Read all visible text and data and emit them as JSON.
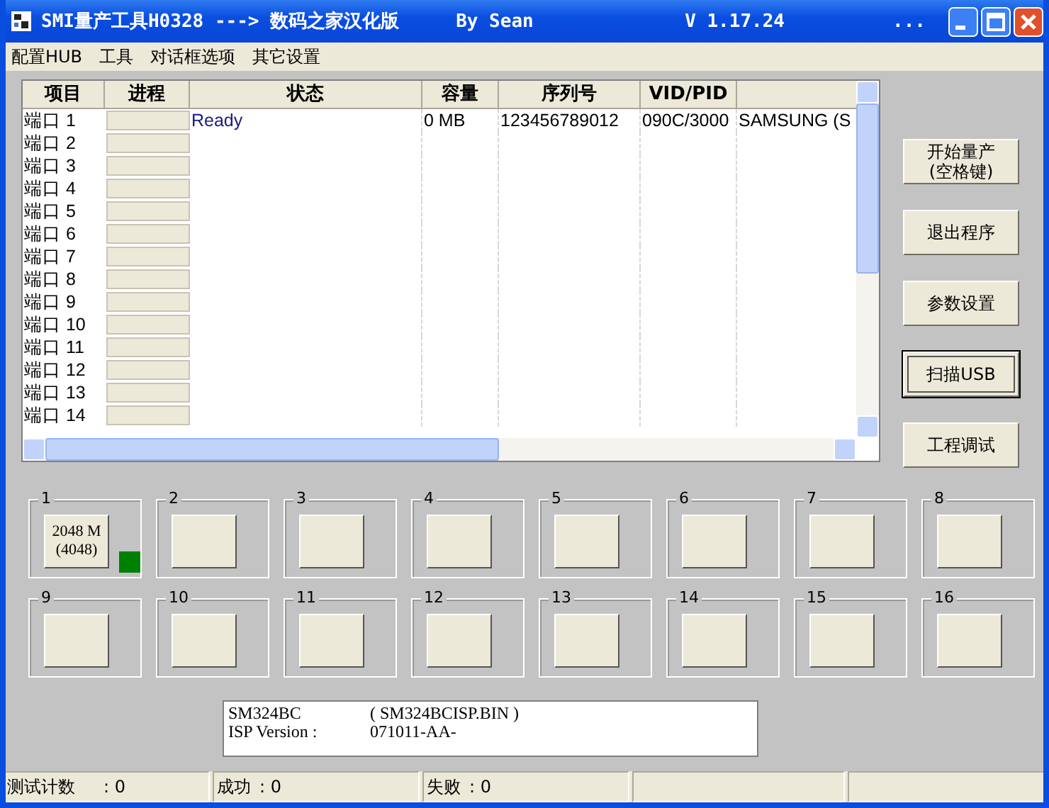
{
  "window": {
    "title": "SMI量产工具H0328 ---> 数码之家汉化版",
    "author": "By Sean",
    "version": "V 1.17.24",
    "extra": "..."
  },
  "menu": [
    "配置HUB",
    "工具",
    "对话框选项",
    "其它设置"
  ],
  "table": {
    "columns": [
      "项目",
      "进程",
      "状态",
      "容量",
      "序列号",
      "VID/PID"
    ],
    "rows": [
      {
        "port": "端口 1",
        "status": "Ready",
        "capacity": "0 MB",
        "serial": "123456789012",
        "vidpid": "090C/3000",
        "column_7": "SAMSUNG (S",
        "level": 0
      },
      {
        "port": "端口 2",
        "level": 0
      },
      {
        "port": "端口 3",
        "level": 0
      },
      {
        "port": "端口 4",
        "level": 0
      },
      {
        "port": "端口 5",
        "level": 0
      },
      {
        "port": "端口 6",
        "level": 0
      },
      {
        "port": "端口 7",
        "level": 0
      },
      {
        "port": "端口 8",
        "level": 0
      },
      {
        "port": "端口 9",
        "level": 0
      },
      {
        "port": "端口 10",
        "level": 0
      },
      {
        "port": "端口 11",
        "level": 0
      },
      {
        "port": "端口 12",
        "level": 0
      },
      {
        "port": "端口 13",
        "level": 0
      },
      {
        "port": "端口 14",
        "level": 0
      }
    ]
  },
  "buttons": [
    {
      "label": "开始量产",
      "label_2": "(空格键)",
      "focused": false
    },
    {
      "label": "退出程序",
      "focused": false
    },
    {
      "label": "参数设置",
      "focused": false
    },
    {
      "label": "扫描USB",
      "focused": true
    },
    {
      "label": "工程调试",
      "focused": false
    }
  ],
  "ports": [
    {
      "number": "1",
      "size": "2048 M",
      "count": "(4048)",
      "color": "#008000"
    },
    {
      "number": "2"
    },
    {
      "number": "3"
    },
    {
      "number": "4"
    },
    {
      "number": "5"
    },
    {
      "number": "6"
    },
    {
      "number": "7"
    },
    {
      "number": "8"
    },
    {
      "number": "9"
    },
    {
      "number": "10"
    },
    {
      "number": "11"
    },
    {
      "number": "12"
    },
    {
      "number": "13"
    },
    {
      "number": "14"
    },
    {
      "number": "15"
    },
    {
      "number": "16"
    }
  ],
  "info": [
    {
      "label": "SM324BC",
      "value": "( SM324BCISP.BIN )"
    },
    {
      "label": "ISP Version :",
      "value": "071011-AA-"
    }
  ],
  "status_bar": [
    {
      "label": "测试计数",
      "value": ": 0"
    },
    {
      "label": "成功",
      "value": ": 0"
    },
    {
      "label": "失败",
      "value": ": 0"
    }
  ]
}
